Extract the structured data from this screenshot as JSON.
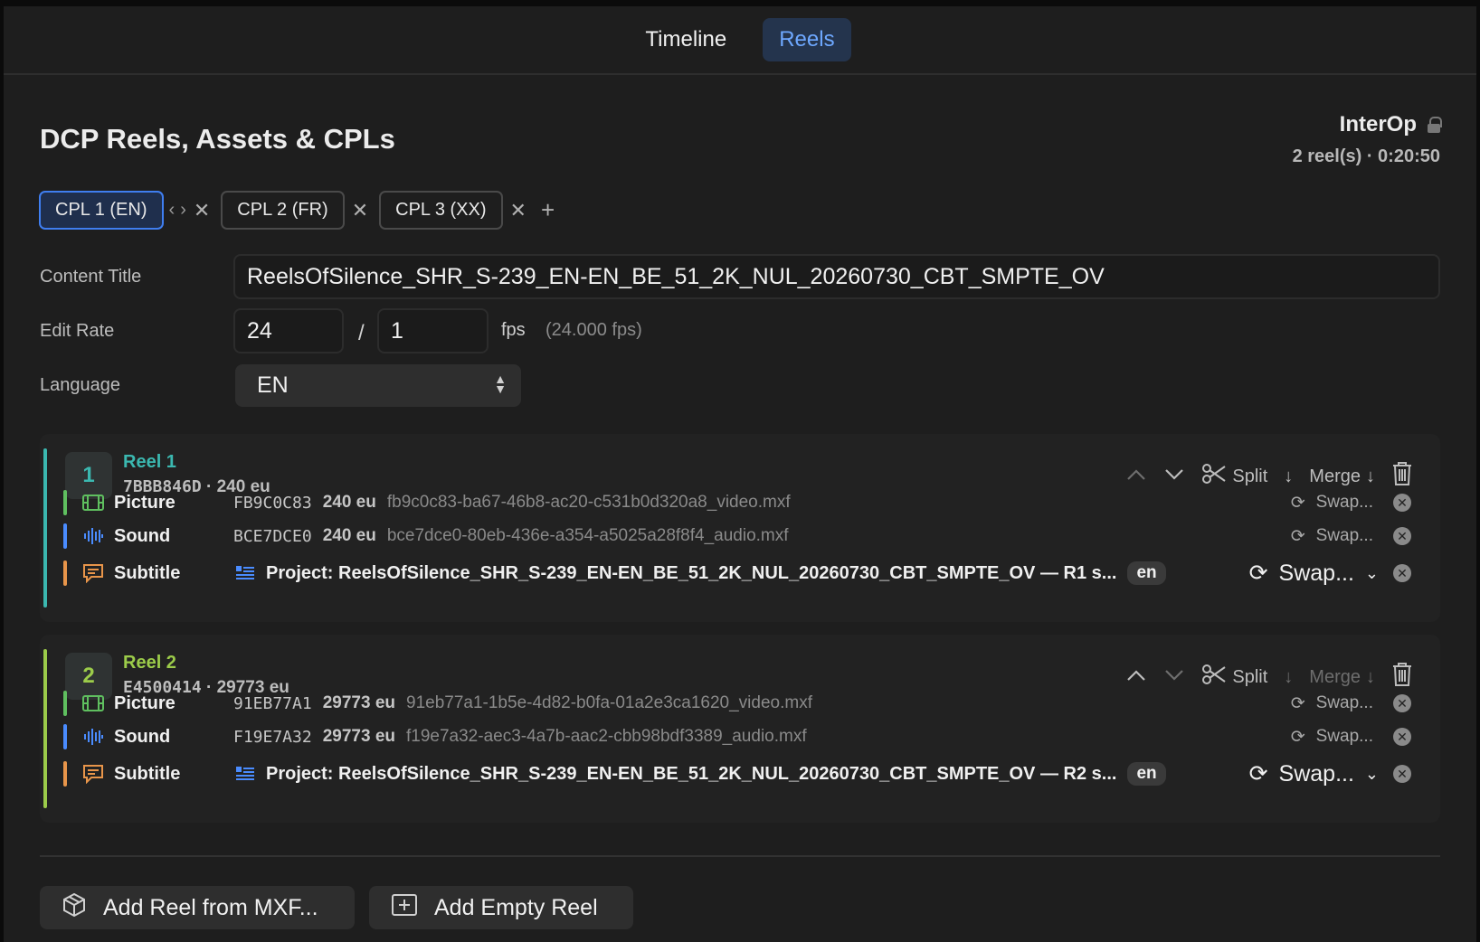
{
  "top_tabs": {
    "timeline": "Timeline",
    "reels": "Reels"
  },
  "header": {
    "title": "DCP Reels, Assets & CPLs",
    "standard": "InterOp",
    "summary": "2 reel(s) · 0:20:50"
  },
  "cpl_tabs": [
    {
      "label": "CPL 1 (EN)",
      "active": true
    },
    {
      "label": "CPL 2 (FR)",
      "active": false
    },
    {
      "label": "CPL 3 (XX)",
      "active": false
    }
  ],
  "form": {
    "content_title_label": "Content Title",
    "content_title_value": "ReelsOfSilence_SHR_S-239_EN-EN_BE_51_2K_NUL_20260730_CBT_SMPTE_OV",
    "edit_rate_label": "Edit Rate",
    "edit_rate_num": "24",
    "edit_rate_den": "1",
    "fps_label": "fps",
    "fps_value": "(24.000 fps)",
    "language_label": "Language",
    "language_value": "EN"
  },
  "reel_tools": {
    "split": "Split",
    "merge": "Merge"
  },
  "reels": [
    {
      "number": "1",
      "name": "Reel 1",
      "id": "7BBB846D",
      "duration": "· 240 eu",
      "color": "#3bb8b0",
      "assets": {
        "picture": {
          "type": "Picture",
          "hash": "FB9C0C83",
          "eu": "240 eu",
          "file": "fb9c0c83-ba67-46b8-ac20-c531b0d320a8_video.mxf",
          "swap": "Swap..."
        },
        "sound": {
          "type": "Sound",
          "hash": "BCE7DCE0",
          "eu": "240 eu",
          "file": "bce7dce0-80eb-436e-a354-a5025a28f8f4_audio.mxf",
          "swap": "Swap..."
        },
        "subtitle": {
          "type": "Subtitle",
          "project": "Project: ReelsOfSilence_SHR_S-239_EN-EN_BE_51_2K_NUL_20260730_CBT_SMPTE_OV — R1 s...",
          "lang": "en",
          "swap": "Swap..."
        }
      }
    },
    {
      "number": "2",
      "name": "Reel 2",
      "id": "E4500414",
      "duration": "· 29773 eu",
      "color": "#9ccc4a",
      "assets": {
        "picture": {
          "type": "Picture",
          "hash": "91EB77A1",
          "eu": "29773 eu",
          "file": "91eb77a1-1b5e-4d82-b0fa-01a2e3ca1620_video.mxf",
          "swap": "Swap..."
        },
        "sound": {
          "type": "Sound",
          "hash": "F19E7A32",
          "eu": "29773 eu",
          "file": "f19e7a32-aec3-4a7b-aac2-cbb98bdf3389_audio.mxf",
          "swap": "Swap..."
        },
        "subtitle": {
          "type": "Subtitle",
          "project": "Project: ReelsOfSilence_SHR_S-239_EN-EN_BE_51_2K_NUL_20260730_CBT_SMPTE_OV — R2 s...",
          "lang": "en",
          "swap": "Swap..."
        }
      }
    }
  ],
  "bottom": {
    "add_from_mxf": "Add Reel from MXF...",
    "add_empty": "Add Empty Reel"
  },
  "colors": {
    "accent": "#3f7ef0",
    "picture": "#5fbf5f",
    "sound": "#4a8cff",
    "subtitle": "#e8954a"
  }
}
